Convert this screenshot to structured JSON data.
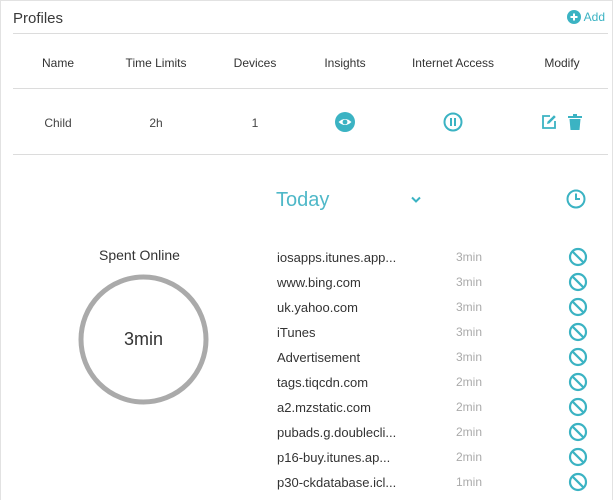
{
  "header": {
    "title": "Profiles",
    "add_label": "Add"
  },
  "table": {
    "columns": [
      "Name",
      "Time Limits",
      "Devices",
      "Insights",
      "Internet Access",
      "Modify"
    ],
    "row": {
      "name": "Child",
      "time_limits": "2h",
      "devices": "1"
    }
  },
  "insights": {
    "period": "Today",
    "spent_label": "Spent Online",
    "spent_value": "3min",
    "sites": [
      {
        "name": "iosapps.itunes.app...",
        "time": "3min"
      },
      {
        "name": "www.bing.com",
        "time": "3min"
      },
      {
        "name": "uk.yahoo.com",
        "time": "3min"
      },
      {
        "name": "iTunes",
        "time": "3min"
      },
      {
        "name": "Advertisement",
        "time": "3min"
      },
      {
        "name": "tags.tiqcdn.com",
        "time": "2min"
      },
      {
        "name": "a2.mzstatic.com",
        "time": "2min"
      },
      {
        "name": "pubads.g.doublecli...",
        "time": "2min"
      },
      {
        "name": "p16-buy.itunes.ap...",
        "time": "2min"
      },
      {
        "name": "p30-ckdatabase.icl...",
        "time": "1min"
      }
    ]
  },
  "icons": {
    "add": "plus-circle-icon",
    "insights": "eye-icon",
    "internet_access": "pause-icon",
    "edit": "edit-icon",
    "delete": "trash-icon",
    "dropdown": "chevron-down-icon",
    "history": "clock-icon",
    "block": "block-icon"
  },
  "colors": {
    "accent": "#3bb3c3",
    "ring": "#aaaaaa",
    "divider": "#dcdcdc"
  }
}
